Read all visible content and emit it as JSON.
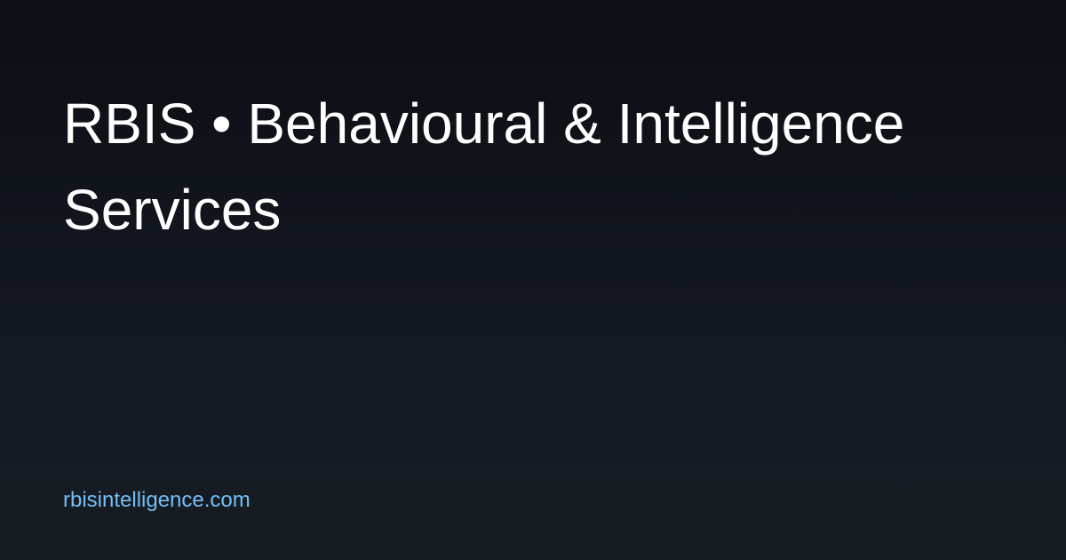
{
  "title": "RBIS • Behavioural & Intelligence Services",
  "url": "rbisintelligence.com",
  "colors": {
    "background_top": "#0c0f14",
    "background_bottom": "#171c23",
    "title": "#ffffff",
    "url": "#72bff8"
  }
}
